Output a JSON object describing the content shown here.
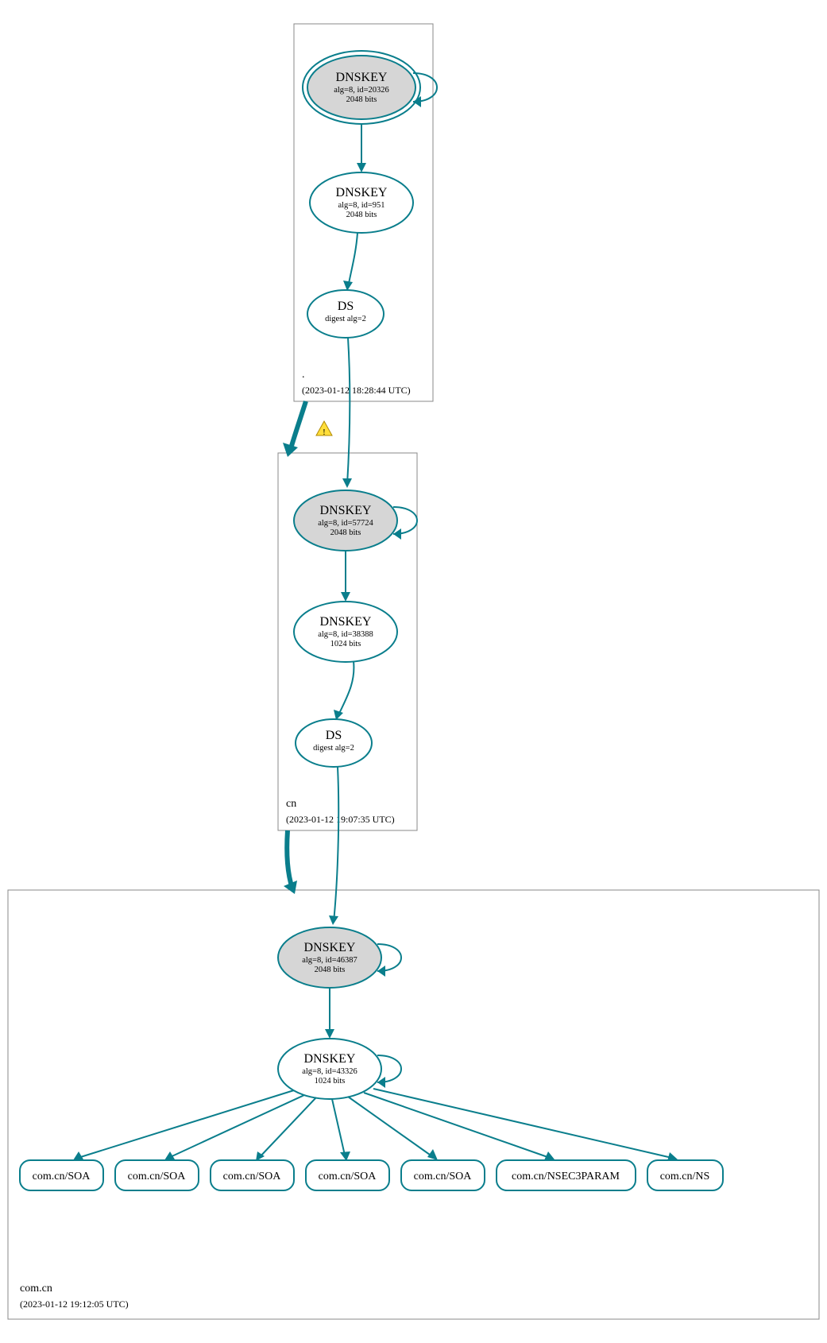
{
  "colors": {
    "stroke": "#0a7e8c",
    "ksk_fill": "#d6d6d6",
    "zsk_fill": "#ffffff"
  },
  "zones": {
    "root": {
      "label": ".",
      "timestamp": "(2023-01-12 18:28:44 UTC)",
      "ksk": {
        "title": "DNSKEY",
        "line1": "alg=8, id=20326",
        "line2": "2048 bits"
      },
      "zsk": {
        "title": "DNSKEY",
        "line1": "alg=8, id=951",
        "line2": "2048 bits"
      },
      "ds": {
        "title": "DS",
        "line1": "digest alg=2"
      }
    },
    "cn": {
      "label": "cn",
      "timestamp": "(2023-01-12 19:07:35 UTC)",
      "ksk": {
        "title": "DNSKEY",
        "line1": "alg=8, id=57724",
        "line2": "2048 bits"
      },
      "zsk": {
        "title": "DNSKEY",
        "line1": "alg=8, id=38388",
        "line2": "1024 bits"
      },
      "ds": {
        "title": "DS",
        "line1": "digest alg=2"
      }
    },
    "comcn": {
      "label": "com.cn",
      "timestamp": "(2023-01-12 19:12:05 UTC)",
      "ksk": {
        "title": "DNSKEY",
        "line1": "alg=8, id=46387",
        "line2": "2048 bits"
      },
      "zsk": {
        "title": "DNSKEY",
        "line1": "alg=8, id=43326",
        "line2": "1024 bits"
      }
    }
  },
  "leaves": [
    "com.cn/SOA",
    "com.cn/SOA",
    "com.cn/SOA",
    "com.cn/SOA",
    "com.cn/SOA",
    "com.cn/NSEC3PARAM",
    "com.cn/NS"
  ],
  "warning_icon": "⚠"
}
